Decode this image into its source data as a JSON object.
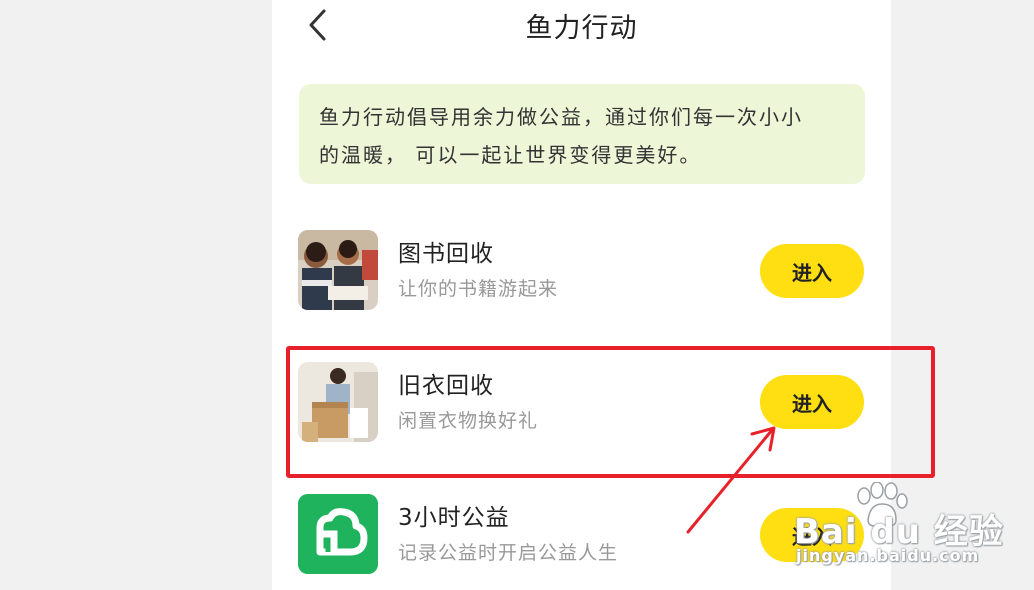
{
  "header": {
    "title": "鱼力行动",
    "back_icon": "chevron-left-icon"
  },
  "intro": {
    "text_line1": "鱼力行动倡导用余力做公益，通过你们每一次小小",
    "text_line2": "的温暖， 可以一起让世界变得更美好。",
    "background_color": "#eef6d8"
  },
  "items": [
    {
      "title": "图书回收",
      "subtitle": "让你的书籍游起来",
      "button_label": "进入",
      "thumb": "children-reading-photo"
    },
    {
      "title": "旧衣回收",
      "subtitle": "闲置衣物换好礼",
      "button_label": "进入",
      "thumb": "person-packing-clothes-photo"
    },
    {
      "title": "3小时公益",
      "subtitle": "记录公益时开启公益人生",
      "button_label": "进入",
      "thumb": "green-cloud-logo-icon"
    }
  ],
  "colors": {
    "button": "#ffdf12",
    "highlight": "#e8202a",
    "green_logo": "#1fb35e"
  },
  "watermark": {
    "brand": "Bai du 经验",
    "url": "jingyan.baidu.com"
  }
}
